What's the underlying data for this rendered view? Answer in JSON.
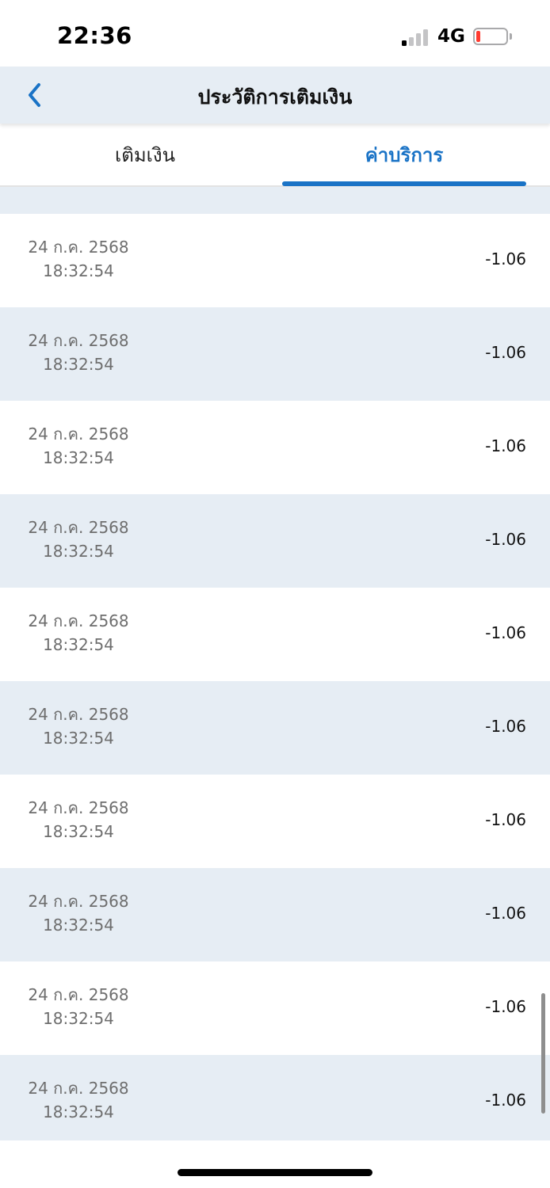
{
  "status_bar": {
    "time": "22:36",
    "network": "4G",
    "signal_bars_active": 1,
    "signal_bars_total": 4,
    "battery_level": 0.15,
    "battery_color": "#ff3b30"
  },
  "nav": {
    "title": "ประวัติการเติมเงิน",
    "back_icon": "chevron-left-icon",
    "background": "#e6edf4"
  },
  "tabs": [
    {
      "label": "เติมเงิน",
      "active": false
    },
    {
      "label": "ค่าบริการ",
      "active": true
    }
  ],
  "accent_color": "#1a73c6",
  "transactions": [
    {
      "date": "24 ก.ค. 2568",
      "time": "18:32:54",
      "amount": "-1.06"
    },
    {
      "date": "24 ก.ค. 2568",
      "time": "18:32:54",
      "amount": "-1.06"
    },
    {
      "date": "24 ก.ค. 2568",
      "time": "18:32:54",
      "amount": "-1.06"
    },
    {
      "date": "24 ก.ค. 2568",
      "time": "18:32:54",
      "amount": "-1.06"
    },
    {
      "date": "24 ก.ค. 2568",
      "time": "18:32:54",
      "amount": "-1.06"
    },
    {
      "date": "24 ก.ค. 2568",
      "time": "18:32:54",
      "amount": "-1.06"
    },
    {
      "date": "24 ก.ค. 2568",
      "time": "18:32:54",
      "amount": "-1.06"
    },
    {
      "date": "24 ก.ค. 2568",
      "time": "18:32:54",
      "amount": "-1.06"
    },
    {
      "date": "24 ก.ค. 2568",
      "time": "18:32:54",
      "amount": "-1.06"
    },
    {
      "date": "24 ก.ค. 2568",
      "time": "18:32:54",
      "amount": "-1.06"
    }
  ]
}
